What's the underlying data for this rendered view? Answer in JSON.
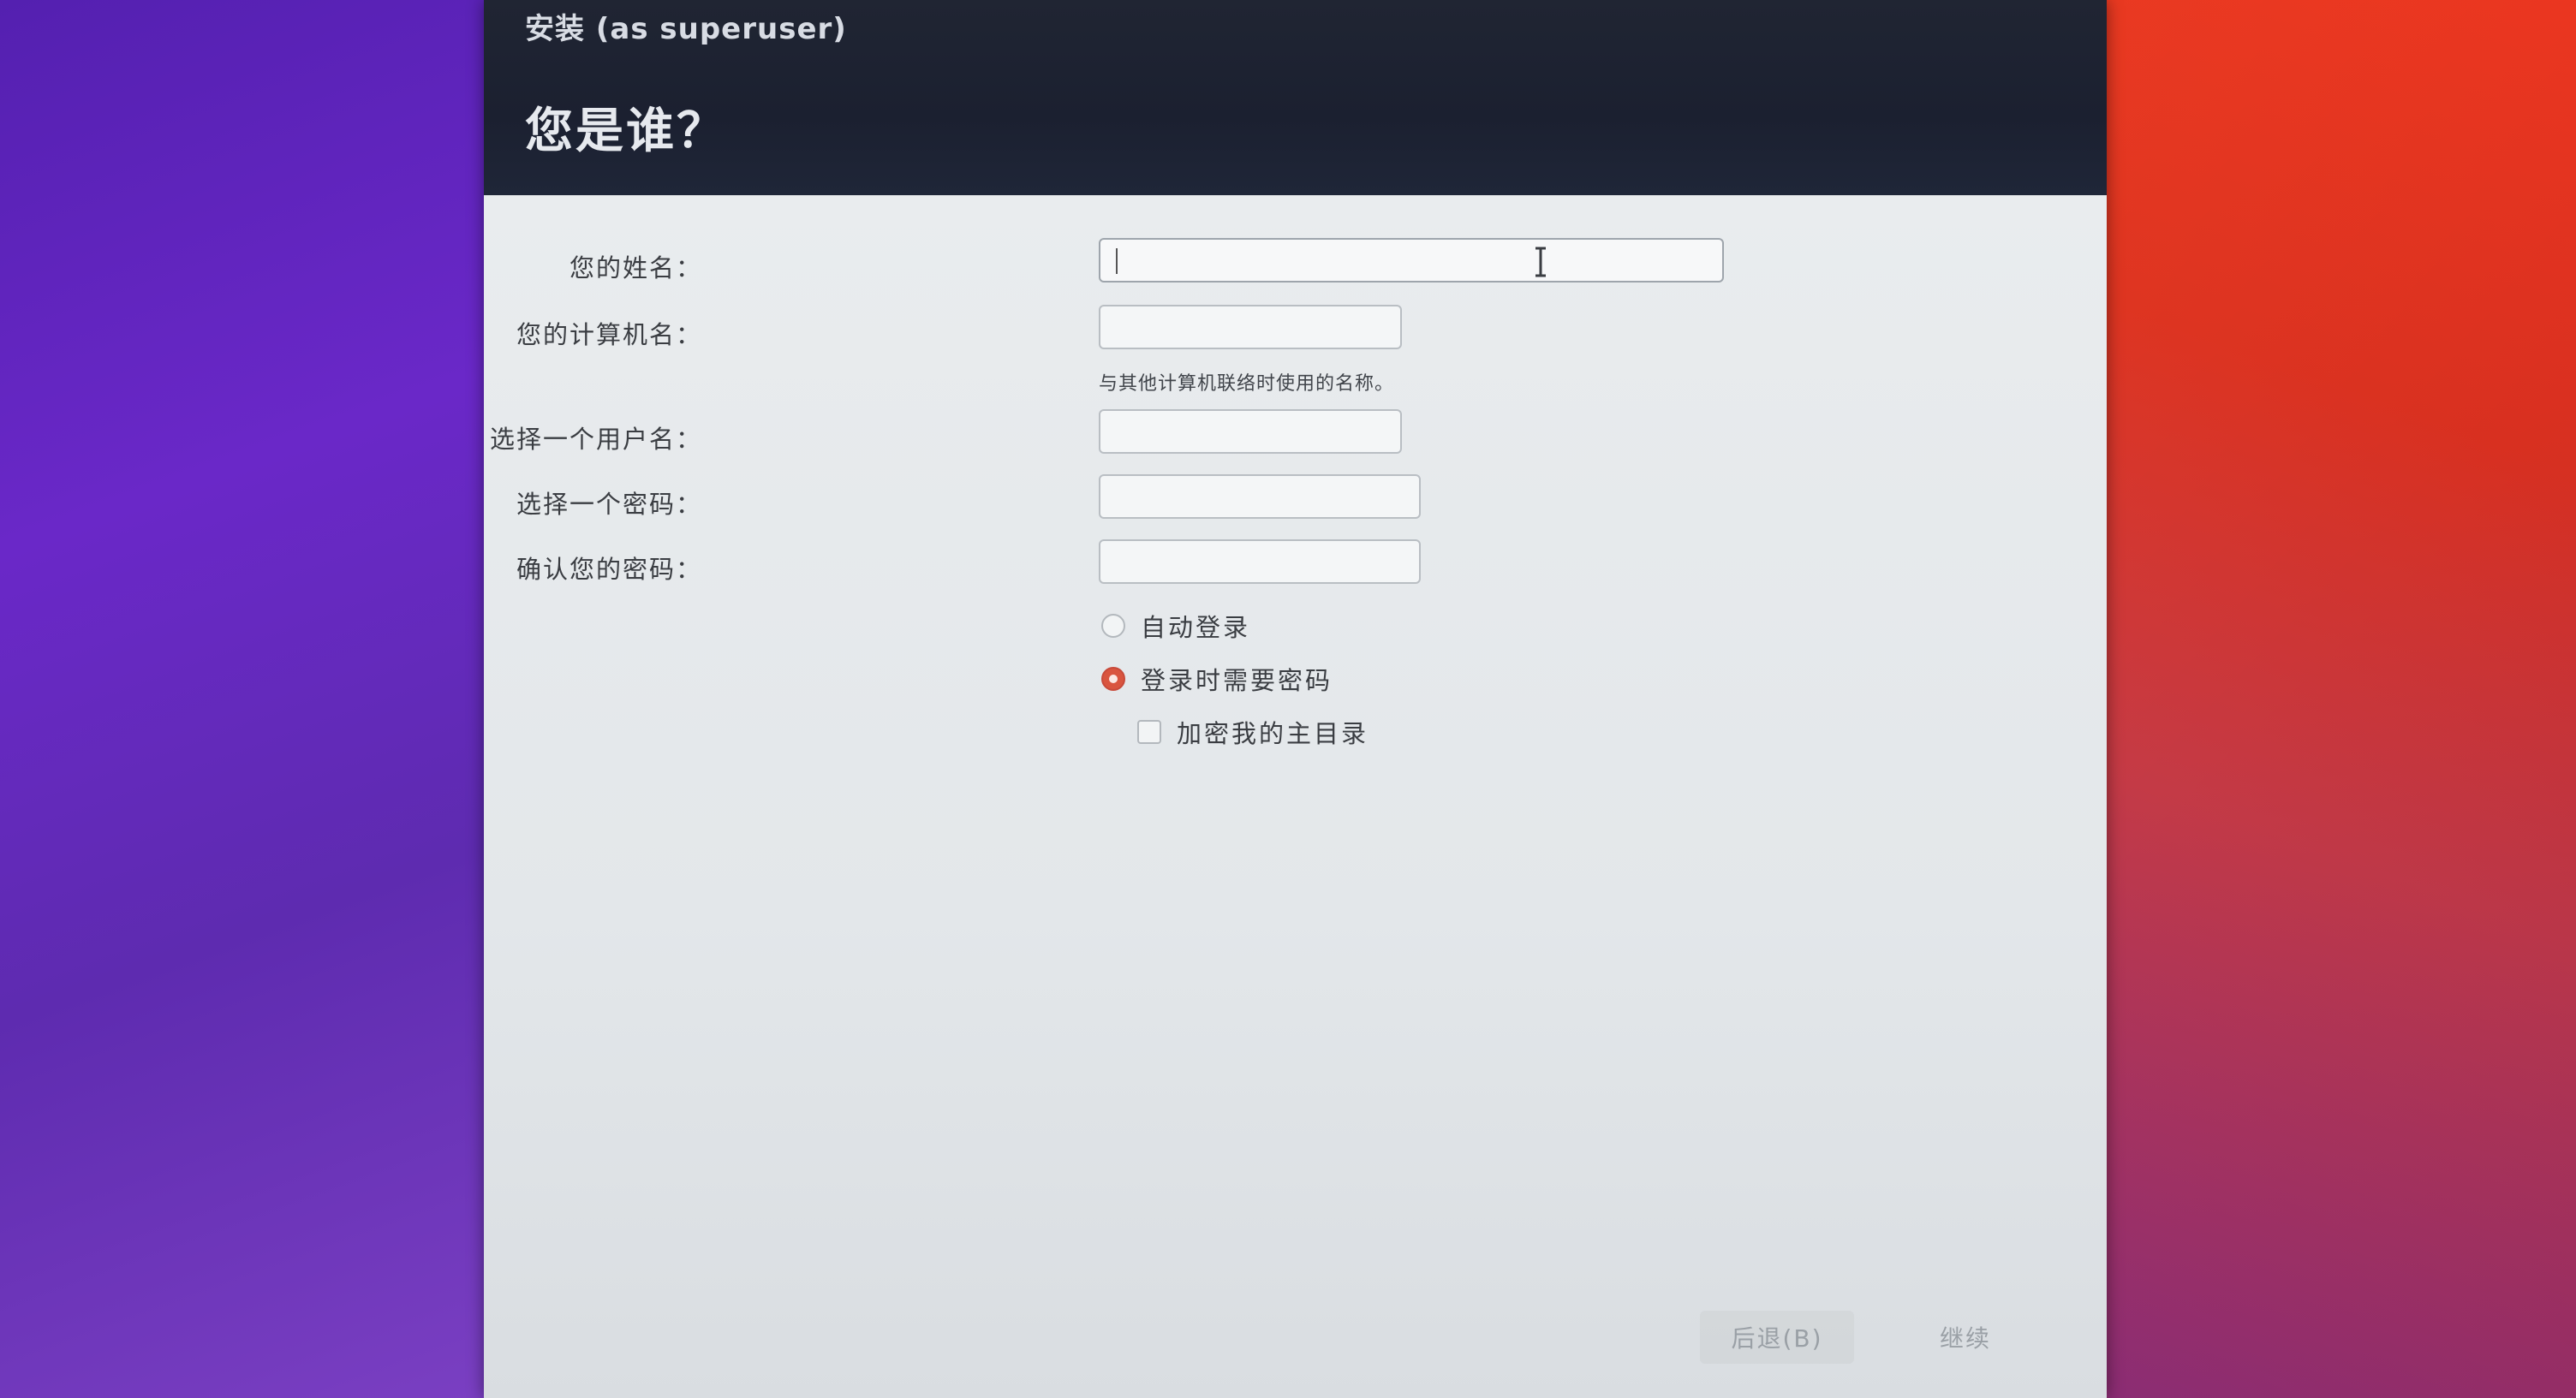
{
  "window": {
    "title": "安装 (as superuser)",
    "heading": "您是谁？"
  },
  "form": {
    "name_label": "您的姓名：",
    "name_value": "",
    "computer_label": "您的计算机名：",
    "computer_value": "",
    "computer_hint": "与其他计算机联络时使用的名称。",
    "username_label": "选择一个用户名：",
    "username_value": "",
    "password_label": "选择一个密码：",
    "confirm_label": "确认您的密码："
  },
  "login_options": {
    "auto_login": "自动登录",
    "auto_login_selected": false,
    "require_password": "登录时需要密码",
    "require_password_selected": true,
    "encrypt_home": "加密我的主目录",
    "encrypt_home_checked": false
  },
  "buttons": {
    "back": "后退(B)",
    "continue": "继续"
  },
  "colors": {
    "header_bg": "#1b2030",
    "content_bg": "#e6e9eb",
    "accent": "#d9553f"
  }
}
